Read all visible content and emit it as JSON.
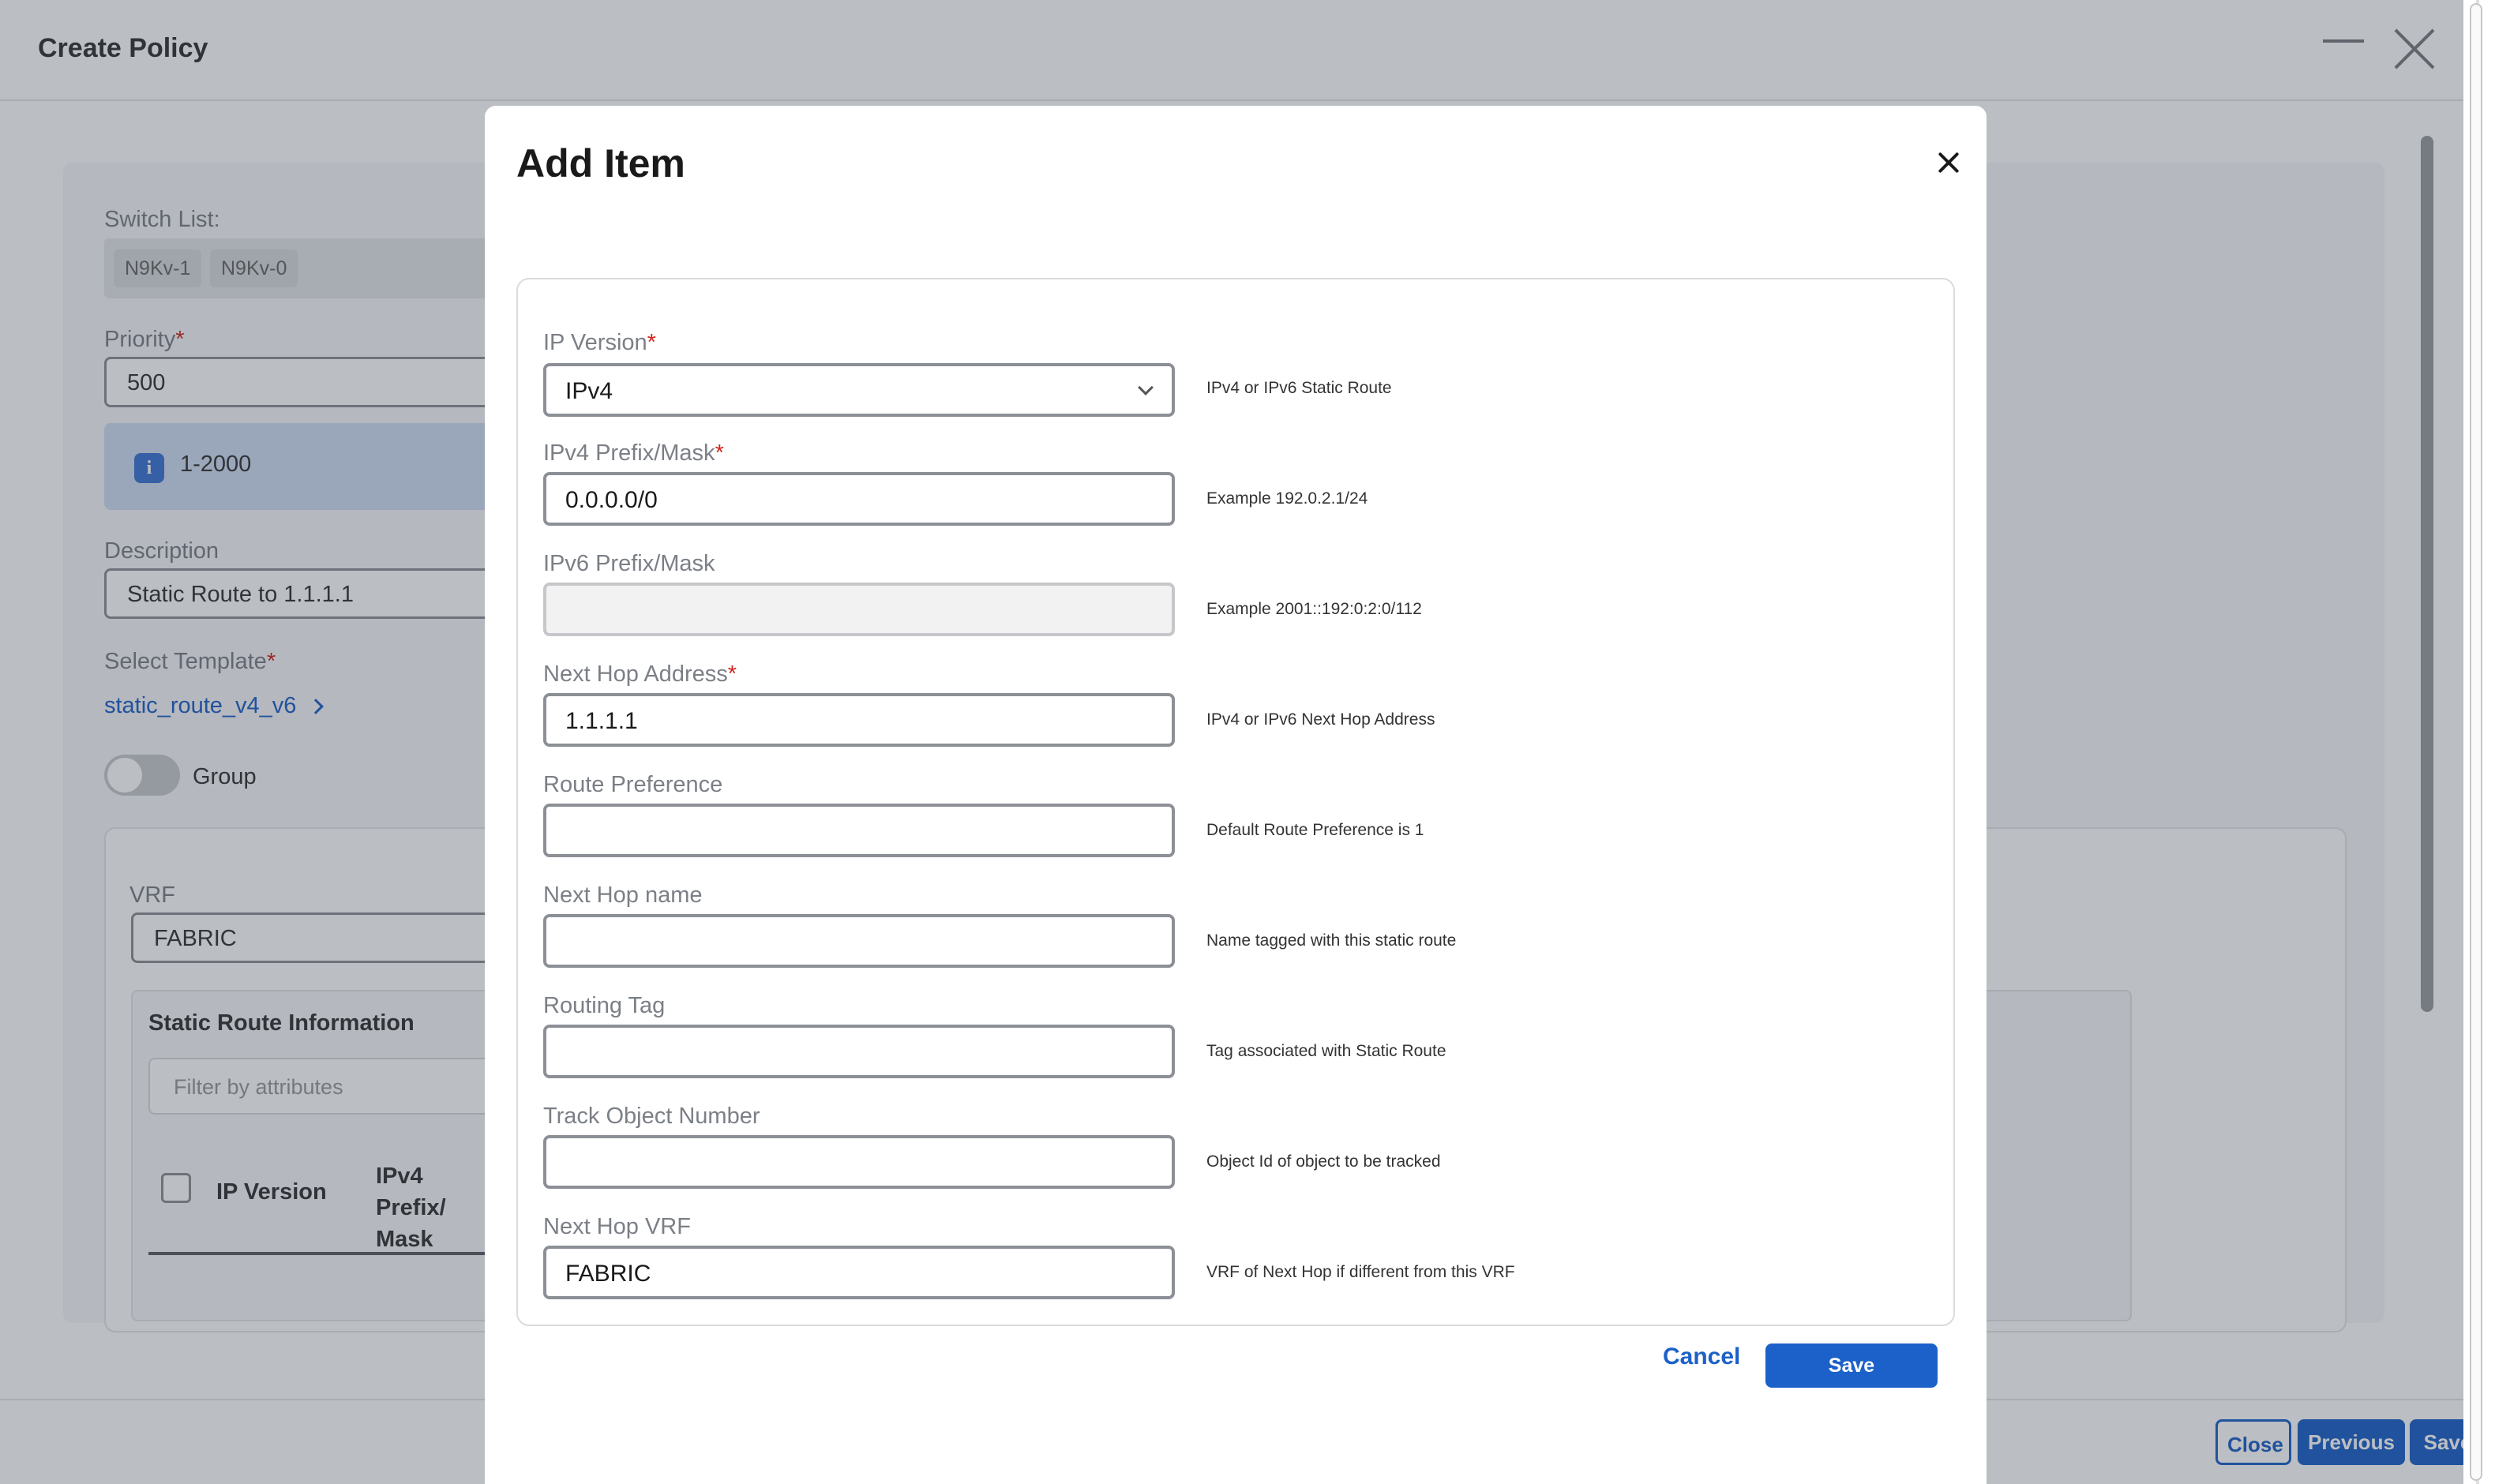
{
  "window": {
    "title": "Create Policy"
  },
  "background_form": {
    "switch_list_label": "Switch List:",
    "switches": [
      "N9Kv-1",
      "N9Kv-0"
    ],
    "priority_label": "Priority",
    "priority_value": "500",
    "priority_range": "1-2000",
    "description_label": "Description",
    "description_value": "Static Route to 1.1.1.1",
    "select_template_label": "Select Template",
    "template_link": "static_route_v4_v6",
    "group_toggle_label": "Group",
    "group_toggle_on": false,
    "vrf_label": "VRF",
    "vrf_value": "FABRIC",
    "static_route_title": "Static Route Information",
    "filter_placeholder": "Filter by attributes",
    "table_headers": [
      "IP Version",
      "IPv4 Prefix/ Mask"
    ]
  },
  "footer": {
    "close_label": "Close",
    "previous_label": "Previous",
    "save_label": "Save"
  },
  "modal": {
    "title": "Add Item",
    "fields": {
      "ip_version": {
        "label": "IP Version",
        "value": "IPv4",
        "help": "IPv4 or IPv6 Static Route"
      },
      "ipv4_prefix": {
        "label": "IPv4 Prefix/Mask",
        "value": "0.0.0.0/0",
        "help": "Example 192.0.2.1/24"
      },
      "ipv6_prefix": {
        "label": "IPv6 Prefix/Mask",
        "value": "",
        "help": "Example 2001::192:0:2:0/112"
      },
      "next_hop_address": {
        "label": "Next Hop Address",
        "value": "1.1.1.1",
        "help": "IPv4 or IPv6 Next Hop Address"
      },
      "route_preference": {
        "label": "Route Preference",
        "value": "",
        "help": "Default Route Preference is 1"
      },
      "next_hop_name": {
        "label": "Next Hop name",
        "value": "",
        "help": "Name tagged with this static route"
      },
      "routing_tag": {
        "label": "Routing Tag",
        "value": "",
        "help": "Tag associated with Static Route"
      },
      "track_object_number": {
        "label": "Track Object Number",
        "value": "",
        "help": "Object Id of object to be tracked"
      },
      "next_hop_vrf": {
        "label": "Next Hop VRF",
        "value": "FABRIC",
        "help": "VRF of Next Hop if different from this VRF"
      }
    },
    "required_marker": "*",
    "cancel_label": "Cancel",
    "save_label": "Save"
  },
  "colors": {
    "accent": "#1c61c9",
    "required": "#d0271d",
    "info_bg": "#cfdcf2",
    "overlay": "rgba(45, 52, 64, 0.32)"
  },
  "icons": {
    "window_minimize": "minimize-icon",
    "window_close": "close-icon",
    "info": "info-icon",
    "template_chevron": "chevron-right-icon",
    "select_chevron": "chevron-down-icon",
    "modal_close": "close-icon"
  }
}
